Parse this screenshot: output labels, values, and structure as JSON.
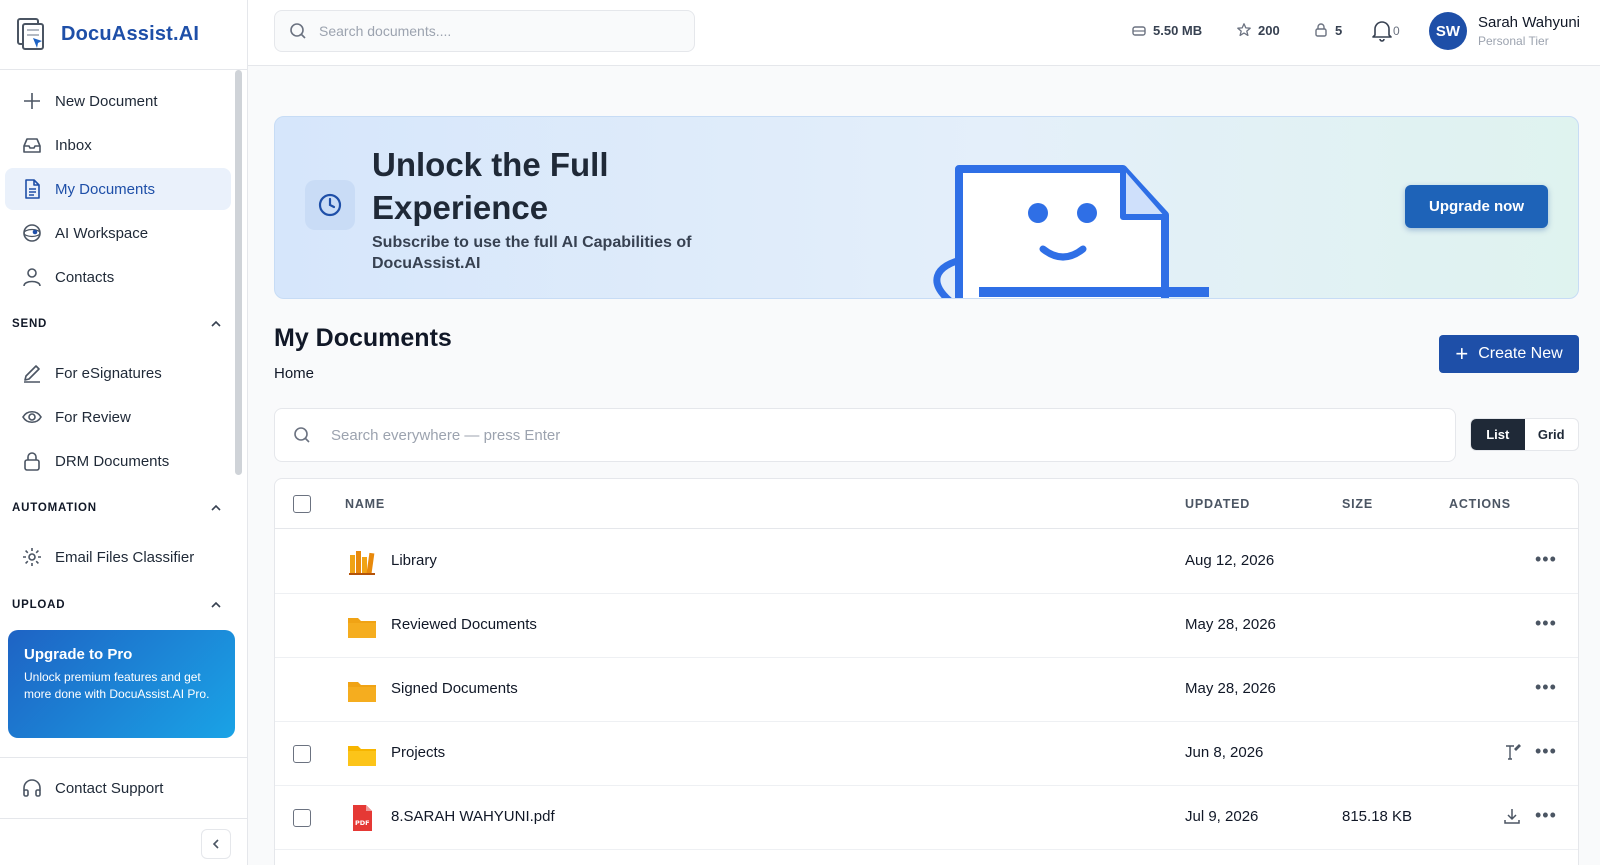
{
  "app": {
    "name": "DocuAssist.AI"
  },
  "topbar": {
    "search_placeholder": "Search documents....",
    "storage": "5.50 MB",
    "credits": "200",
    "locked": "5",
    "notifications": "0",
    "user": {
      "initials": "SW",
      "name": "Sarah Wahyuni",
      "tier": "Personal Tier"
    }
  },
  "sidebar": {
    "items": [
      {
        "label": "New Document",
        "icon": "plus-icon"
      },
      {
        "label": "Inbox",
        "icon": "inbox-icon"
      },
      {
        "label": "My Documents",
        "icon": "document-icon",
        "active": true
      },
      {
        "label": "AI Workspace",
        "icon": "ai-globe-icon"
      },
      {
        "label": "Contacts",
        "icon": "user-icon"
      }
    ],
    "sections": {
      "send": {
        "title": "SEND",
        "items": [
          "For eSignatures",
          "For Review",
          "DRM Documents"
        ]
      },
      "automation": {
        "title": "AUTOMATION",
        "items": [
          "Email Files Classifier"
        ]
      },
      "upload": {
        "title": "UPLOAD"
      }
    },
    "promo": {
      "title": "Upgrade to Pro",
      "text": "Unlock premium features and get more done with DocuAssist.AI Pro."
    },
    "support": "Contact Support"
  },
  "banner": {
    "title": "Unlock the Full Experience",
    "subtitle": "Subscribe to use the full AI Capabilities of DocuAssist.AI",
    "button": "Upgrade now"
  },
  "main": {
    "title": "My Documents",
    "breadcrumb": "Home",
    "create_button": "Create New",
    "search_placeholder": "Search everywhere — press Enter",
    "view_toggle": {
      "list": "List",
      "grid": "Grid",
      "selected": "List"
    },
    "columns": {
      "name": "NAME",
      "updated": "UPDATED",
      "size": "SIZE",
      "actions": "ACTIONS"
    },
    "rows": [
      {
        "name": "Library",
        "updated": "Aug 12, 2026",
        "size": "",
        "type": "library"
      },
      {
        "name": "Reviewed Documents",
        "updated": "May 28, 2026",
        "size": "",
        "type": "folder"
      },
      {
        "name": "Signed Documents",
        "updated": "May 28, 2026",
        "size": "",
        "type": "folder"
      },
      {
        "name": "Projects",
        "updated": "Jun 8, 2026",
        "size": "",
        "type": "folder"
      },
      {
        "name": "8.SARAH WAHYUNI.pdf",
        "updated": "Jul 9, 2026",
        "size": "815.18 KB",
        "type": "pdf"
      }
    ]
  },
  "colors": {
    "brand": "#1e4fa8",
    "folder": "#f0a315",
    "pdf": "#e53935",
    "accent": "#1e63c4"
  }
}
